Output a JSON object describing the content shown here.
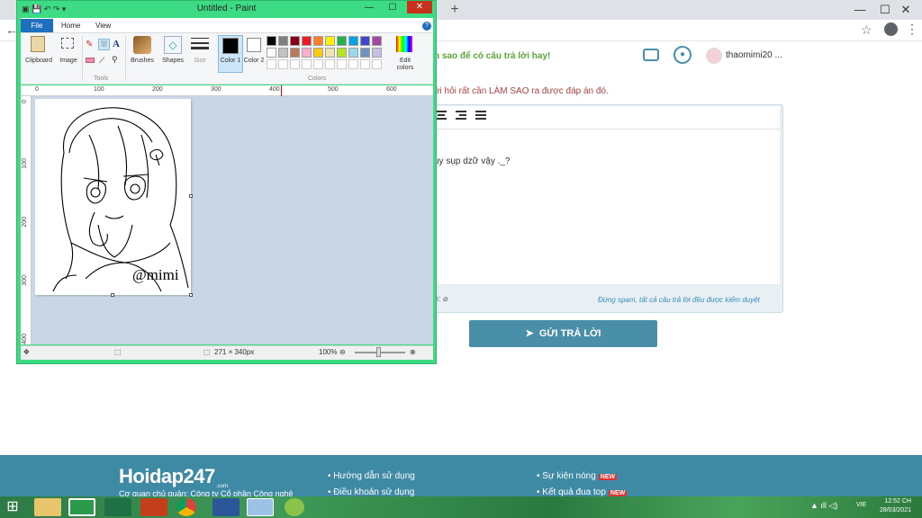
{
  "browser": {
    "new_tab": "+",
    "minimize": "—",
    "maximize": "☐",
    "close": "✕",
    "back": "←",
    "star": "☆",
    "menu": "⋮"
  },
  "site": {
    "headline": "h sao để có câu trả lời hay!",
    "username": "thaomimi20 ...",
    "note": "ới hỏi rất cần LÀM SAO ra được đáp án đó.",
    "editor_text": "uy sụp dzữ vậy ._?",
    "attach_label": "h:",
    "spam_note": "Đừng spam, tất cả câu trả lời đều được kiểm duyệt",
    "submit_label": "GỬI TRẢ LỜI",
    "footer": {
      "logo": "Hoidap247",
      "logo_suffix": ".com",
      "description": "Cơ quan chủ quản: Công ty Cổ phần Công nghệ",
      "links_col1": [
        "Hướng dẫn sử dụng",
        "Điều khoản sử dụng"
      ],
      "links_col2": [
        "Sự kiện nóng",
        "Kết quả đua top"
      ],
      "new_badge": "NEW"
    }
  },
  "paint": {
    "title": "Untitled - Paint",
    "tabs": {
      "file": "File",
      "home": "Home",
      "view": "View"
    },
    "help": "?",
    "groups": {
      "clipboard": "Clipboard",
      "image": "Image",
      "tools": "Tools",
      "brushes": "Brushes",
      "shapes": "Shapes",
      "size": "Size",
      "color1": "Color 1",
      "color2": "Color 2",
      "colors": "Colors",
      "edit_colors": "Edit colors"
    },
    "palette_row1": [
      "#000000",
      "#7f7f7f",
      "#880015",
      "#ed1c24",
      "#ff7f27",
      "#fff200",
      "#22b14c",
      "#00a2e8",
      "#3f48cc",
      "#a349a4"
    ],
    "palette_row2": [
      "#ffffff",
      "#c3c3c3",
      "#b97a57",
      "#ffaec9",
      "#ffc90e",
      "#efe4b0",
      "#b5e61d",
      "#99d9ea",
      "#7092be",
      "#c8bfe7"
    ],
    "ruler_h": [
      "0",
      "100",
      "200",
      "300",
      "400",
      "500",
      "600"
    ],
    "ruler_v": [
      "0",
      "100",
      "200",
      "300",
      "400"
    ],
    "signature": "@mimi",
    "status": {
      "dimensions": "271 × 340px",
      "zoom": "100%"
    }
  },
  "taskbar": {
    "start": "⊞",
    "tray": "▲  ıll  ◁)",
    "lang": "VIE",
    "time": "12:52 CH",
    "date": "28/03/2021"
  }
}
